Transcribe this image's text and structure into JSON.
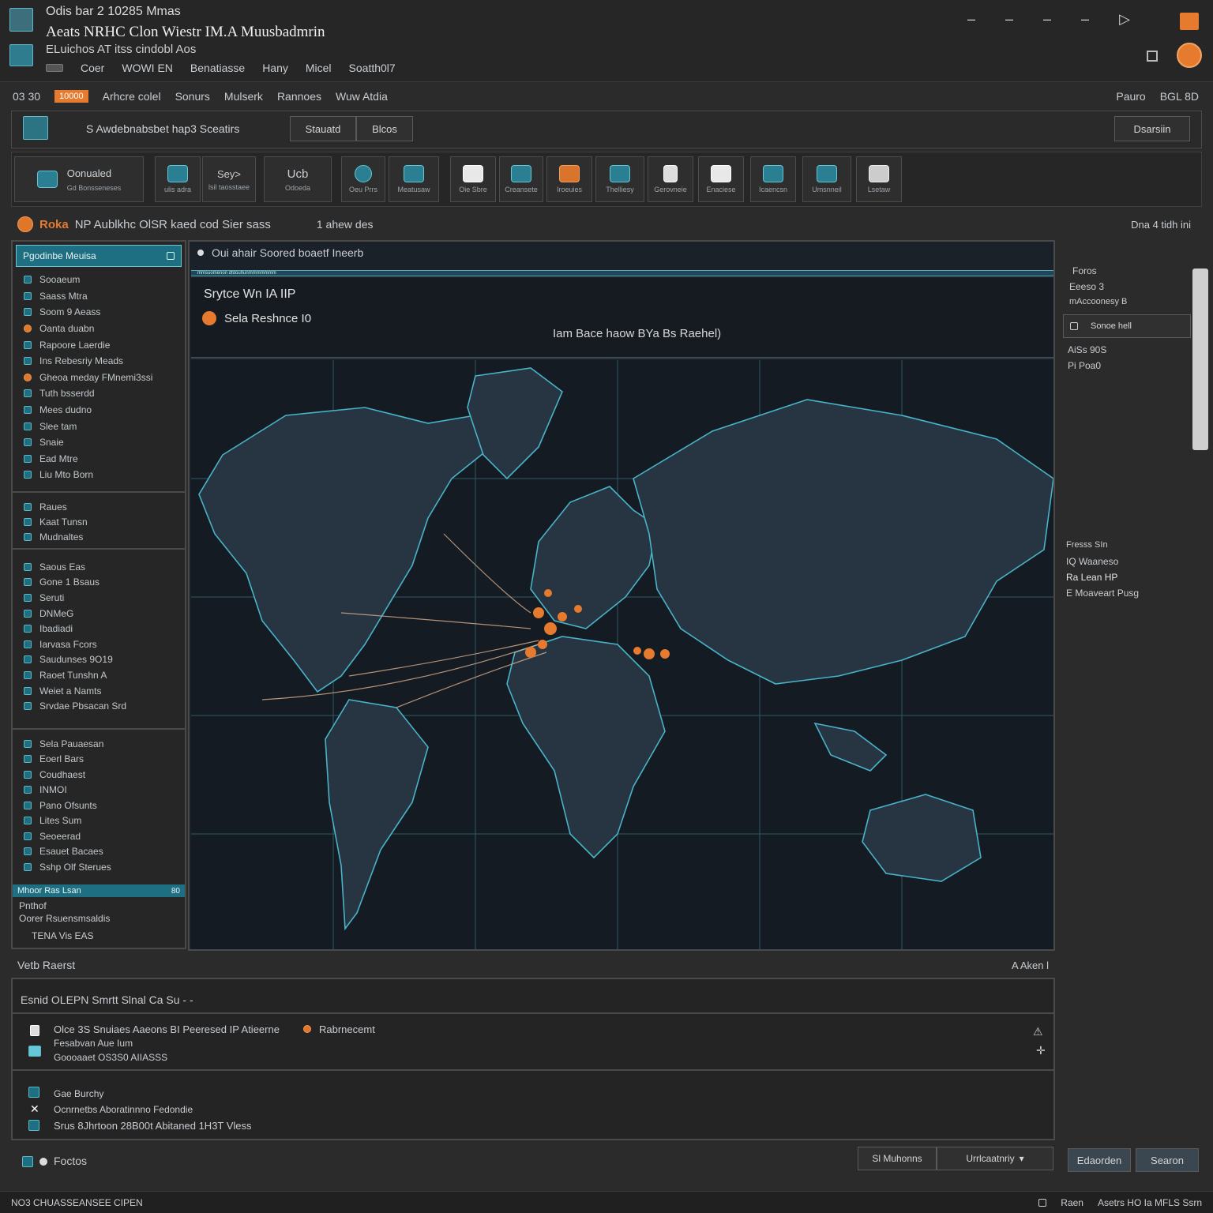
{
  "window": {
    "title_line1": "Odis bar 2 10285 Mmas",
    "title_line2": "Aeats NRHC Clon Wiestr IM.A Muusbadmrin",
    "title_line3": "ELuichos   AT itss cindobl Aos",
    "menus": [
      "Coer",
      "WOWI EN",
      "Benatiasse",
      "Hany",
      "Micel",
      "Soatth0l7"
    ],
    "controls": [
      "–",
      "–",
      "–",
      "–",
      "▷"
    ]
  },
  "toolbar": {
    "left_label": "03 30",
    "badge": "10000",
    "items": [
      "Arhcre colel",
      "Sonurs",
      "Mulserk",
      "Rannoes",
      "Wuw Atdia"
    ],
    "right_a": "Pauro",
    "right_b": "BGL 8D"
  },
  "search": {
    "text": "S Awdebnabsbet hap3 Sceatirs",
    "btn1": "Stauatd",
    "btn2": "Blcos",
    "right_btn": "Dsarsiin"
  },
  "tools": [
    {
      "label": "Oonualed",
      "sub": "Gd Bonsseneses"
    },
    {
      "label": "",
      "sub": "ulis adra"
    },
    {
      "label": "Sey>",
      "sub": "lsil taosstaee"
    },
    {
      "label": "Ucb",
      "sub": "Odoeda"
    },
    {
      "label": "",
      "sub": "Oeu Prrs"
    },
    {
      "label": "",
      "sub": "Meatusaw"
    },
    {
      "label": "",
      "sub": "Oie Sbre"
    },
    {
      "label": "",
      "sub": "Creansete"
    },
    {
      "label": "",
      "sub": "Iroeuies"
    },
    {
      "label": "",
      "sub": "Thelliesy"
    },
    {
      "label": "",
      "sub": "Gerovneie"
    },
    {
      "label": "",
      "sub": "Enaciese"
    },
    {
      "label": "",
      "sub": "Icaencsn"
    },
    {
      "label": "",
      "sub": "Umsnneil"
    },
    {
      "label": "",
      "sub": "Lsetaw"
    }
  ],
  "breadcrumb": {
    "app": "Roka",
    "path": "NP Aublkhc OlSR kaed cod Sier sass",
    "right": "1 ahew des",
    "far_right": "Dna 4 tidh ini"
  },
  "left_panel": {
    "header": "Pgodinbe Meuisa",
    "group1": [
      "Sooaeum",
      "Saass Mtra",
      "Soom 9 Aeass",
      "Oanta duabn",
      "Rapoore Laerdie",
      "Ins Rebesriy Meads",
      "Gheoa meday FMnemi3ssi",
      "Tuth bsserdd",
      "Mees dudno",
      "Slee tam",
      "Snaie",
      "Ead Mtre",
      "Liu Mto Born"
    ],
    "group2": [
      "Raues",
      "Kaat Tunsn",
      "Mudnaltes"
    ],
    "group3": [
      "Saous Eas",
      "Gone 1 Bsaus",
      "Seruti",
      "DNMeG",
      "Ibadiadi",
      "Iarvasa Fcors",
      "Saudunses 9O19",
      "Raoet Tunshn A",
      "Weiet a Namts",
      "Srvdae Pbsacan Srd"
    ],
    "group4": [
      "Sela Pauaesan",
      "Eoerl Bars",
      "Coudhaest",
      "INMOI",
      "Pano Ofsunts",
      "Lites Sum",
      "Seoeerad",
      "Esauet Bacaes",
      "Sshp Olf Sterues"
    ],
    "footer_bar": "Mhoor Ras Lsan",
    "footer_tag": "80",
    "footer_lines": [
      "Pnthof",
      "Oorer Rsuensmsaldis",
      "TENA Vis EAS"
    ]
  },
  "map": {
    "tab": "Oui ahair Soored boaetf Ineerb",
    "title": "Srytce Wn IA IIP",
    "legend": "Sela Reshnce I0",
    "center_label": "Iam Bace haow BYa Bs Raehel)",
    "strip": "mmsuomenon dfdouhunmmmmmmm"
  },
  "right_panel": {
    "lines1": [
      "Foros",
      "Eeeso 3",
      "mAccoonesy B"
    ],
    "btn": "Sonoe hell",
    "lines2": [
      "AiSs 90S",
      "Pi Poa0"
    ],
    "lines3": [
      "Fresss SIn",
      "IQ Waaneso",
      "Ra Lean HP",
      "E Moaveart Pusg"
    ]
  },
  "bottom": {
    "title": "Vetb Raerst",
    "right": "A  Aken l",
    "filter": "Esnid OLEPN Smrtt Slnal  Ca Su  - -",
    "log1": [
      "Olce 3S Snuiaes Aaeons BI Peeresed IP Atieerne",
      "Fesabvan Aue Ium",
      "Goooaaet OS3S0 AIIASSS"
    ],
    "log1_tag": "Rabrnecemt",
    "log2": [
      "Gae Burchy",
      "Ocnrnetbs Aboratinnno Fedondie",
      "Srus 8Jhrtoon 28B00t Abitaned 1H3T Vless"
    ],
    "status_left": "Foctos",
    "tabs": [
      "Sl Muhonns",
      "Urrlcaatnriy"
    ],
    "buttons": [
      "Edaorden",
      "Searon"
    ]
  },
  "statusbar": {
    "left": "NO3 CHUASSEANSEE CIPEN",
    "right_a": "Raen",
    "right_b": "Asetrs HO Ia MFLS Ssrn"
  }
}
